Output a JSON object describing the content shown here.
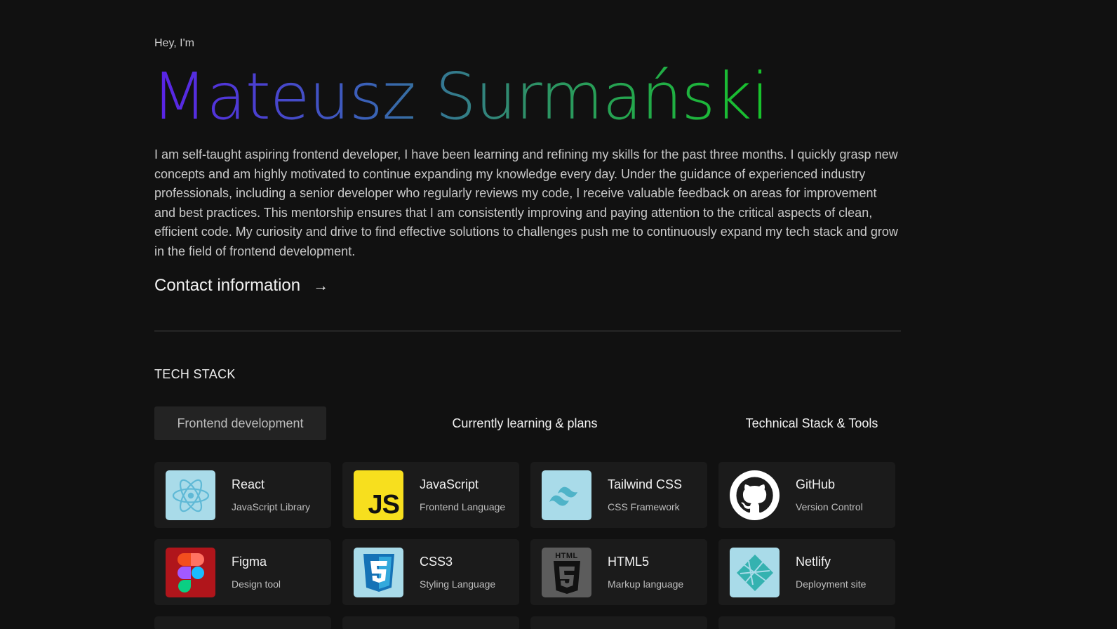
{
  "hero": {
    "greeting": "Hey, I'm",
    "name": "Mateusz Surmański",
    "bio": "I am self-taught aspiring frontend developer, I have been learning and refining my skills for the past three months. I quickly grasp new concepts and am highly motivated to continue expanding my knowledge every day. Under the guidance of experienced industry professionals, including a senior developer who regularly reviews my code, I receive valuable feedback on areas for improvement and best practices. This mentorship ensures that I am consistently improving and paying attention to the critical aspects of clean, efficient code. My curiosity and drive to find effective solutions to challenges push me to continuously expand my tech stack and grow in the field of frontend development.",
    "contact_label": "Contact information",
    "contact_arrow": "→",
    "name_gradient": [
      "#5b21e8",
      "#17c42a"
    ]
  },
  "tech": {
    "section_title": "TECH STACK",
    "tabs": [
      {
        "label": "Frontend development",
        "active": true
      },
      {
        "label": "Currently learning & plans",
        "active": false
      },
      {
        "label": "Technical Stack & Tools",
        "active": false
      }
    ],
    "cards": [
      {
        "title": "React",
        "subtitle": "JavaScript Library",
        "icon": "react-icon",
        "bg": "#a9dbe9"
      },
      {
        "title": "JavaScript",
        "subtitle": "Frontend Language",
        "icon": "javascript-icon",
        "bg": "#f7df1e"
      },
      {
        "title": "Tailwind CSS",
        "subtitle": "CSS Framework",
        "icon": "tailwind-icon",
        "bg": "#a9dbe9"
      },
      {
        "title": "GitHub",
        "subtitle": "Version Control",
        "icon": "github-icon",
        "bg": "#1b1b1b"
      },
      {
        "title": "Figma",
        "subtitle": "Design tool",
        "icon": "figma-icon",
        "bg": "#b0151b"
      },
      {
        "title": "CSS3",
        "subtitle": "Styling Language",
        "icon": "css3-icon",
        "bg": "#a9dbe9"
      },
      {
        "title": "HTML5",
        "subtitle": "Markup language",
        "icon": "html5-icon",
        "bg": "#5c5c5c"
      },
      {
        "title": "Netlify",
        "subtitle": "Deployment site",
        "icon": "netlify-icon",
        "bg": "#a9dbe9"
      }
    ],
    "js_icon_text": "JS",
    "html_icon_text": "HTML"
  }
}
